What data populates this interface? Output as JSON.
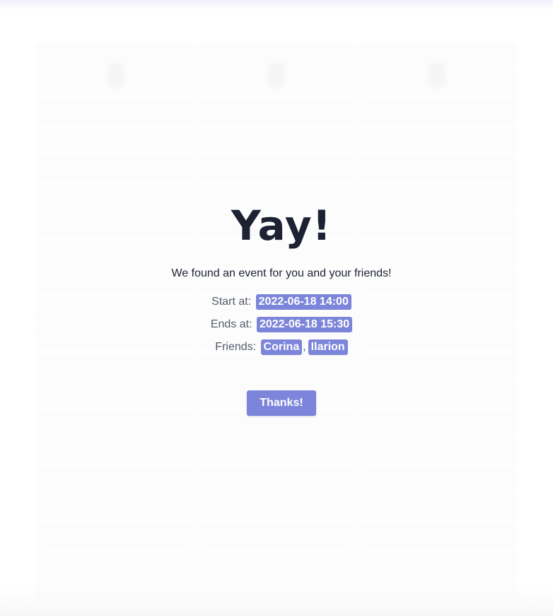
{
  "dialog": {
    "title": "Yay!",
    "message": "We found an event for you and your friends!",
    "start_label": "Start at:",
    "start_value": "2022-06-18 14:00",
    "end_label": "Ends at:",
    "end_value": "2022-06-18 15:30",
    "friends_label": "Friends:",
    "friends": [
      "Corina",
      "Ilarion"
    ],
    "friends_separator": ",",
    "confirm_label": "Thanks!"
  },
  "colors": {
    "accent": "#7c85d9",
    "text_dark": "#1c2232",
    "text_muted": "#555b6a"
  }
}
